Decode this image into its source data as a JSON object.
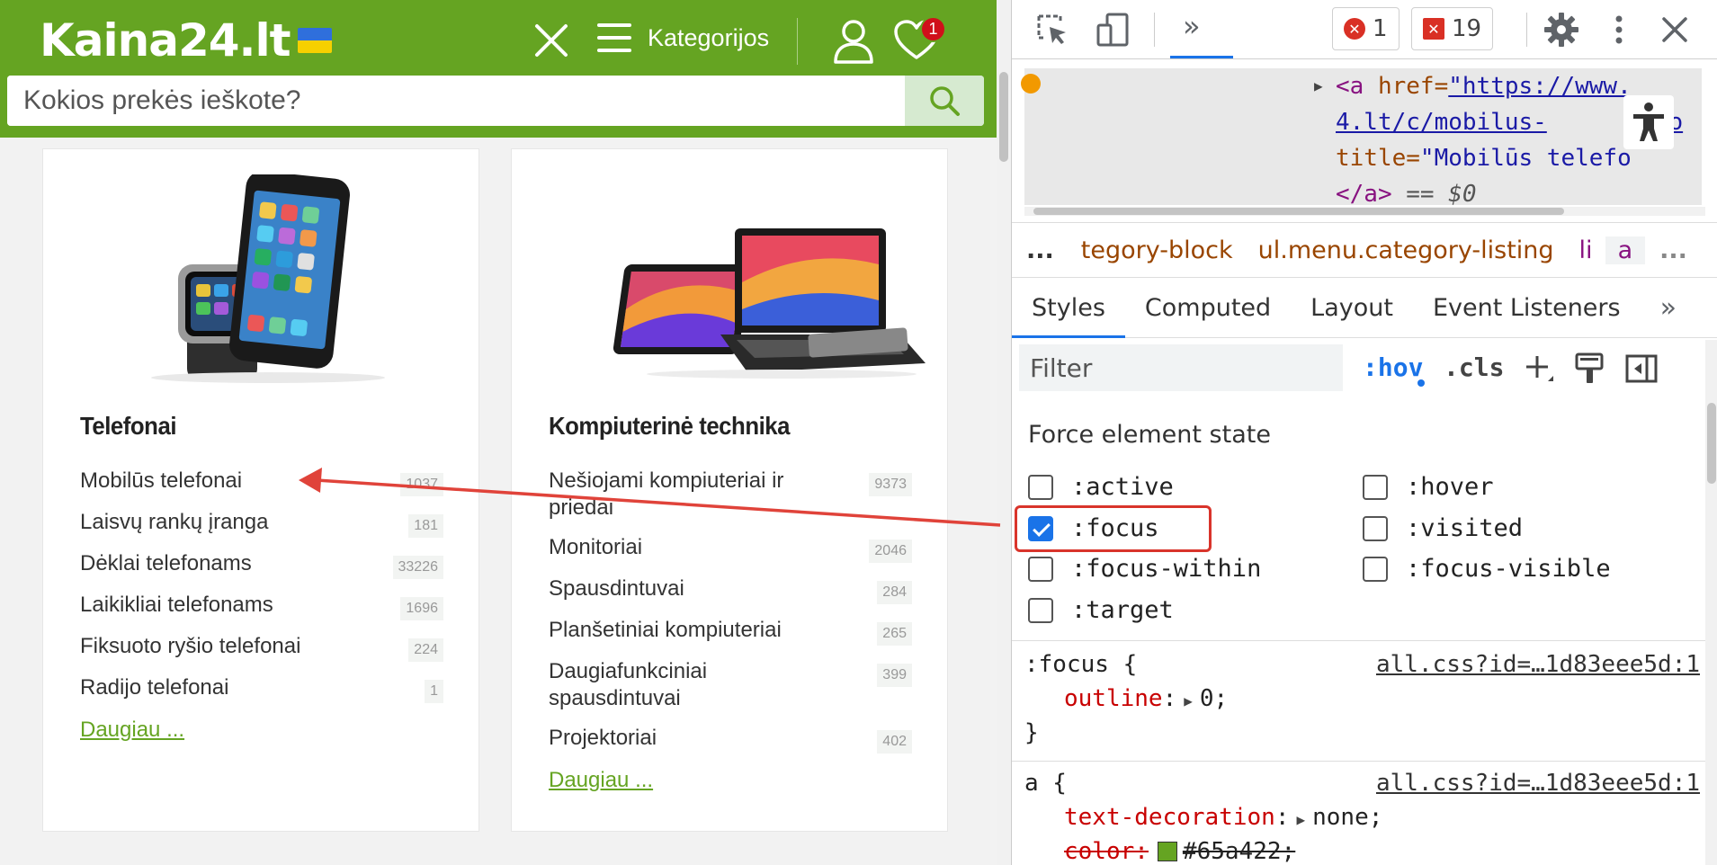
{
  "site": {
    "logo": "Kaina24.lt",
    "header": {
      "categories_label": "Kategorijos",
      "wishlist_count": "1"
    },
    "search": {
      "placeholder": "Kokios prekės ieškote?"
    },
    "cards": [
      {
        "title": "Telefonai",
        "items": [
          {
            "name": "Mobilūs telefonai",
            "count": "1037"
          },
          {
            "name": "Laisvų rankų įranga",
            "count": "181"
          },
          {
            "name": "Dėklai telefonams",
            "count": "33226"
          },
          {
            "name": "Laikikliai telefonams",
            "count": "1696"
          },
          {
            "name": "Fiksuoto ryšio telefonai",
            "count": "224"
          },
          {
            "name": "Radijo telefonai",
            "count": "1"
          }
        ],
        "more": "Daugiau ..."
      },
      {
        "title": "Kompiuterinė technika",
        "items": [
          {
            "name": "Nešiojami kompiuteriai ir priedai",
            "count": "9373"
          },
          {
            "name": "Monitoriai",
            "count": "2046"
          },
          {
            "name": "Spausdintuvai",
            "count": "284"
          },
          {
            "name": "Planšetiniai kompiuteriai",
            "count": "265"
          },
          {
            "name": "Daugiafunkciniai spausdintuvai",
            "count": "399"
          },
          {
            "name": "Projektoriai",
            "count": "402"
          }
        ],
        "more": "Daugiau ..."
      }
    ]
  },
  "devtools": {
    "errors_count": "1",
    "issues_count": "19",
    "dom": {
      "line1_tag": "<a",
      "line1_attr": "href=",
      "line1_val": "\"https://www.",
      "line2_val": "4.lt/c/mobilus-",
      "line2_tail": "fo",
      "line3_attr": "title=",
      "line3_val": "\"Mobilūs telefo",
      "line4_close": "</a>",
      "line4_eq": " == $0"
    },
    "breadcrumb": {
      "ellipsis_left": "...",
      "items": [
        "tegory-block",
        "ul.menu.category-listing",
        "li",
        "a"
      ],
      "ellipsis_right": "..."
    },
    "tabs": [
      "Styles",
      "Computed",
      "Layout",
      "Event Listeners"
    ],
    "filter": {
      "placeholder": "Filter",
      "hov": ":hov",
      "cls": ".cls"
    },
    "force_state": {
      "title": "Force element state",
      "states": [
        {
          "label": ":active",
          "checked": false
        },
        {
          "label": ":hover",
          "checked": false
        },
        {
          "label": ":focus",
          "checked": true
        },
        {
          "label": ":visited",
          "checked": false
        },
        {
          "label": ":focus-within",
          "checked": false
        },
        {
          "label": ":focus-visible",
          "checked": false
        },
        {
          "label": ":target",
          "checked": false
        }
      ]
    },
    "rules": [
      {
        "selector": ":focus {",
        "source": "all.css?id=…1d83eee5d:1",
        "prop": "outline",
        "value": "0;",
        "close": "}"
      },
      {
        "selector": "a {",
        "source": "all.css?id=…1d83eee5d:1",
        "prop1": "text-decoration",
        "value1": "none;",
        "prop2": "color:",
        "value2": "#65a422;"
      }
    ],
    "colors": {
      "accent": "#1a73e8",
      "brand_green": "#65a422",
      "error_red": "#d93025"
    }
  }
}
